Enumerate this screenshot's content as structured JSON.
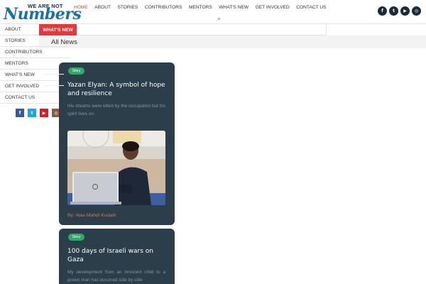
{
  "logo": {
    "line1": "WE ARE NOT",
    "line2": "Numbers"
  },
  "top_nav": [
    "HOME",
    "ABOUT",
    "STORIES",
    "CONTRIBUTORS",
    "MENTORS",
    "WHAT'S NEW",
    "GET INVOLVED",
    "CONTACT US"
  ],
  "top_nav_active": "HOME",
  "social": [
    "facebook",
    "twitter",
    "youtube",
    "instagram"
  ],
  "sidebar": {
    "items": [
      "ABOUT",
      "STORIES",
      "CONTRIBUTORS",
      "MENTORS",
      "WHAT'S NEW",
      "GET INVOLVED",
      "CONTACT US"
    ]
  },
  "badge": "WHAT'S NEW",
  "section_title": "All News",
  "cards": [
    {
      "tag": "Story",
      "title": "Yazan Elyan: A symbol of hope and resilience",
      "excerpt": "His dreams were killed by the occupation but his spirit lives on.",
      "author": "By: Alaa Mahdi Kudaih"
    },
    {
      "tag": "Story",
      "title": "100 days of Israeli wars on Gaza",
      "excerpt": "My development from an innocent child to a grown man has occurred side by side"
    }
  ],
  "colors": {
    "accent": "#e0393e",
    "card_bg": "#2c3e4a",
    "tag_green": "#2eaa6b",
    "navy": "#1c2b3a"
  }
}
